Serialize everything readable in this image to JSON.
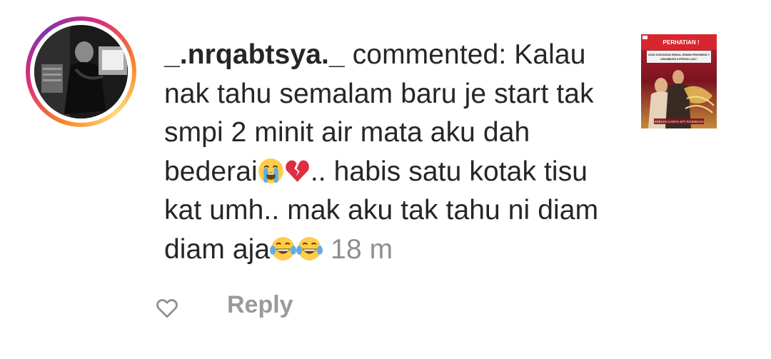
{
  "notification": {
    "username": "_.nrqabtsya._",
    "action": "commented:",
    "text_part1": "Kalau nak tahu semalam baru je start tak smpi 2 minit air mata aku dah bederai",
    "text_part2": ".. habis satu kotak tisu kat umh.. mak aku tak tahu ni diam diam aja",
    "emojis_1": [
      "loudly-crying-face",
      "broken-heart"
    ],
    "emojis_2": [
      "face-with-tears-of-joy",
      "face-with-tears-of-joy"
    ],
    "timestamp": "18 m",
    "reply_label": "Reply",
    "like_icon": "heart-outline-icon"
  },
  "post_thumbnail": {
    "header": "PERHATIAN !",
    "line1": "ATAS SOKONGAN SEMUA, DRAMA FENOMENA !!",
    "line2": "DISAMBUNG 8 EPISOD LAGI !",
    "footer": "SEBUAH KARYA SITI ROSMIZAH"
  },
  "colors": {
    "text": "#262626",
    "secondary": "#8e8e8e",
    "reply": "#9a9a9a",
    "ring_start": "#f58529",
    "ring_end": "#dd2a7b"
  }
}
